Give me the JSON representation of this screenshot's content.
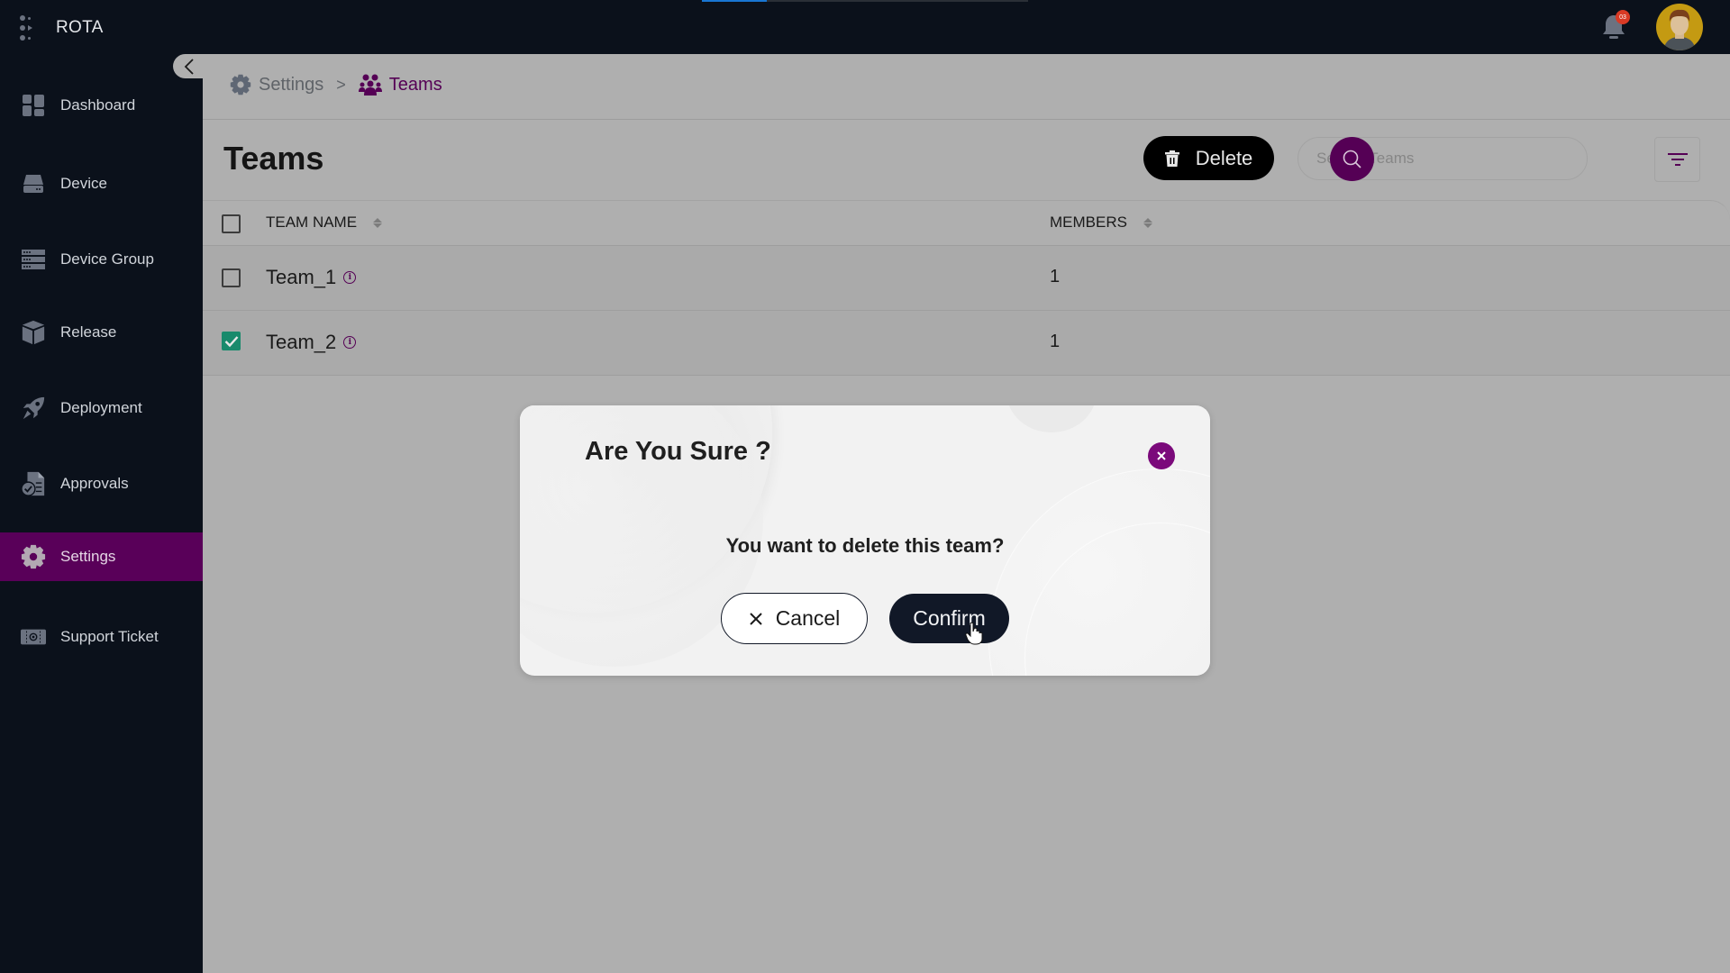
{
  "app": {
    "name": "ROTA",
    "loading_progress_percent": 20,
    "notifications": {
      "badge_count": "03"
    }
  },
  "sidebar": {
    "items": [
      {
        "label": "Dashboard",
        "icon": "dashboard-icon",
        "active": false
      },
      {
        "label": "Device",
        "icon": "device-icon",
        "active": false
      },
      {
        "label": "Device Group",
        "icon": "device-group-icon",
        "active": false
      },
      {
        "label": "Release",
        "icon": "release-box-icon",
        "active": false
      },
      {
        "label": "Deployment",
        "icon": "rocket-icon",
        "active": false
      },
      {
        "label": "Approvals",
        "icon": "approvals-document-icon",
        "active": false
      },
      {
        "label": "Settings",
        "icon": "gear-icon",
        "active": true
      },
      {
        "label": "Support Ticket",
        "icon": "ticket-icon",
        "active": false
      }
    ]
  },
  "breadcrumb": {
    "items": [
      {
        "label": "Settings",
        "icon": "gear-icon"
      },
      {
        "label": "Teams",
        "icon": "users-icon"
      }
    ],
    "separator": ">"
  },
  "page": {
    "title": "Teams",
    "delete_label": "Delete",
    "search_placeholder": "Search Teams",
    "search_value": ""
  },
  "table": {
    "columns": [
      "TEAM NAME",
      "MEMBERS"
    ],
    "rows": [
      {
        "name": "Team_1",
        "members": "1",
        "selected": false
      },
      {
        "name": "Team_2",
        "members": "1",
        "selected": true
      }
    ]
  },
  "modal": {
    "title": "Are You Sure ?",
    "message": "You want to delete this team?",
    "cancel_label": "Cancel",
    "confirm_label": "Confirm"
  },
  "colors": {
    "brand_purple": "#550055",
    "sidebar_bg": "#0b111b",
    "checkbox_green": "#198a6c",
    "confirm_bg": "#111827",
    "progress_blue": "#1976d2"
  }
}
